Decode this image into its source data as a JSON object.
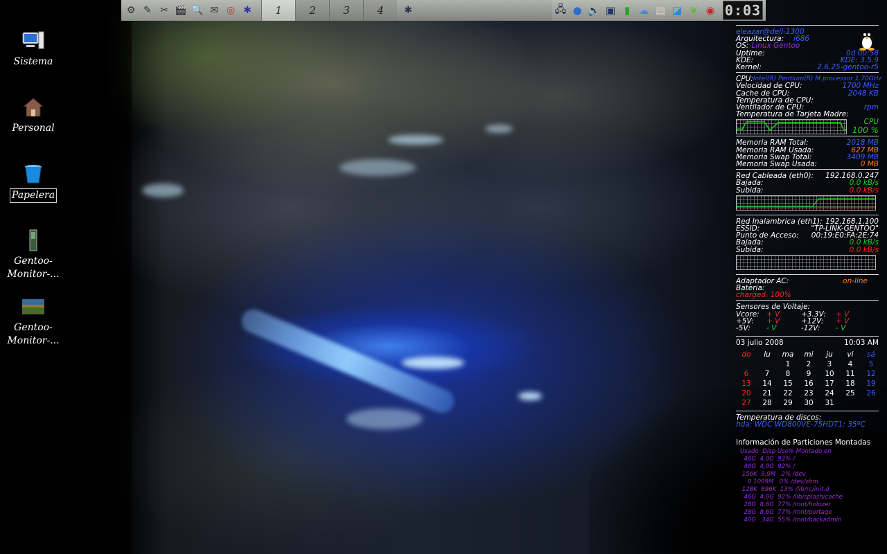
{
  "desktop_icons": [
    {
      "label": "Sistema",
      "icon": "computer-icon"
    },
    {
      "label": "Personal",
      "icon": "home-folder-icon"
    },
    {
      "label": "Papelera",
      "icon": "trash-icon",
      "selected": true
    },
    {
      "label": "Gentoo-Monitor-...",
      "icon": "image-file-icon"
    },
    {
      "label": "Gentoo-Monitor-...",
      "icon": "image-file-icon"
    }
  ],
  "panel": {
    "launchers": [
      "settings-icon",
      "gimp-icon",
      "tools-icon",
      "media-icon",
      "search-icon",
      "mail-icon",
      "lifebuoy-icon",
      "sound-icon"
    ],
    "desktops": [
      "1",
      "2",
      "3",
      "4"
    ],
    "active_desktop": 0,
    "tray": [
      "network-icon",
      "globe-icon",
      "volume-icon",
      "screen-icon",
      "signal-icon",
      "weather-icon",
      "paper-icon",
      "display-icon",
      "leaf-icon",
      "record-icon"
    ],
    "clock": "0:03"
  },
  "conky": {
    "user": "eleazar@dell-1300",
    "arch_label": "Arquitectura:",
    "arch": "i686",
    "os_label": "OS:",
    "os": "Linux Gentoo",
    "uptime_label": "Uptime:",
    "uptime": "0d 00:58",
    "kde_label": "KDE:",
    "kde": "KDE: 3.5.9",
    "kernel_label": "Kernel:",
    "kernel": "2.6.25-gentoo-r5",
    "cpu_label": "CPU:",
    "cpu": "Intel(R) Pentium(R) M processor 1.70GHz",
    "cpu_speed_label": "Velocidad de CPU:",
    "cpu_speed": "1700 MHz",
    "cpu_cache_label": "Cache de CPU:",
    "cpu_cache": "2048 KB",
    "cpu_temp_label": "Temperatura de CPU:",
    "cpu_fan_label": "Ventilador de CPU:",
    "cpu_fan": "rpm",
    "mb_temp_label": "Temperatura de Tarjeta Madre:",
    "cpu_graph_label": "CPU",
    "cpu_percent": "100 %",
    "ram_total_label": "Memoria RAM Total:",
    "ram_total": "2018 MB",
    "ram_used_label": "Memoria RAM Usada:",
    "ram_used": "627 MB",
    "swap_total_label": "Memoria Swap Total:",
    "swap_total": "3409 MB",
    "swap_used_label": "Memoria Swap Usada:",
    "swap_used": "0 MB",
    "eth_label": "Red Cableada (eth0):",
    "eth_ip": "192.168.0.247",
    "down_label": "Bajada:",
    "eth_down": "0.0 kB/s",
    "up_label": "Subida:",
    "eth_up": "0.0 kB/s",
    "wlan_label": "Red Inalambrica (eth1):",
    "wlan_ip": "192.168.1.100",
    "essid_label": "ESSID:",
    "essid": "\"TP-LINK-GENTOO\"",
    "ap_label": "Punto de Acceso:",
    "ap": "00:19:E0:FA:2E:74",
    "wlan_down": "0.0 kB/s",
    "wlan_up": "0.0 kB/s",
    "ac_label": "Adaptador AC:",
    "ac": "on-line",
    "battery_label": "Bateria:",
    "battery": "charged, 100%",
    "volt_label": "Sensores de Voltaje:",
    "vcore_label": "Vcore:",
    "vcore": "+ V",
    "v33_label": "+3.3V:",
    "v33": "+ V",
    "v5_label": "+5V:",
    "v5": "+ V",
    "v12_label": "+12V:",
    "v12": "+ V",
    "vm5_label": "-5V:",
    "vm5": "- V",
    "vm12_label": "-12V:",
    "vm12": "- V",
    "date": "03 julio 2008",
    "time": "10:03 AM",
    "calendar": {
      "headers": [
        "do",
        "lu",
        "ma",
        "mi",
        "ju",
        "vi",
        "sá"
      ],
      "weeks": [
        [
          "",
          "",
          "1",
          "2",
          "3",
          "4",
          "5"
        ],
        [
          "6",
          "7",
          "8",
          "9",
          "10",
          "11",
          "12"
        ],
        [
          "13",
          "14",
          "15",
          "16",
          "17",
          "18",
          "19"
        ],
        [
          "20",
          "21",
          "22",
          "23",
          "24",
          "25",
          "26"
        ],
        [
          "27",
          "28",
          "29",
          "30",
          "31",
          "",
          ""
        ]
      ]
    },
    "disk_temp_label": "Temperatura de discos:",
    "disk_temp": "hda: WDC WD800VE-75HDT1:   35ºC",
    "partitions_title": "Información de Particiones Montadas",
    "partitions_header": "Usado  Disp Uso% Montado en",
    "partitions": [
      "  46G  4,0G  92% /",
      "  46G  4,0G  92% /",
      " 156K  9,9M   2% /dev",
      "    0 1009M   0% /dev/shm",
      " 128K  896K  13% /lib/rc/init.d",
      "  46G  4,0G  92% /lib/splash/cache",
      "  28G  8,6G  77% /mnt/holozer",
      "  28G  8,6G  77% /mnt/portage",
      "  40G   34G  55% /mnt/backadmin"
    ]
  }
}
